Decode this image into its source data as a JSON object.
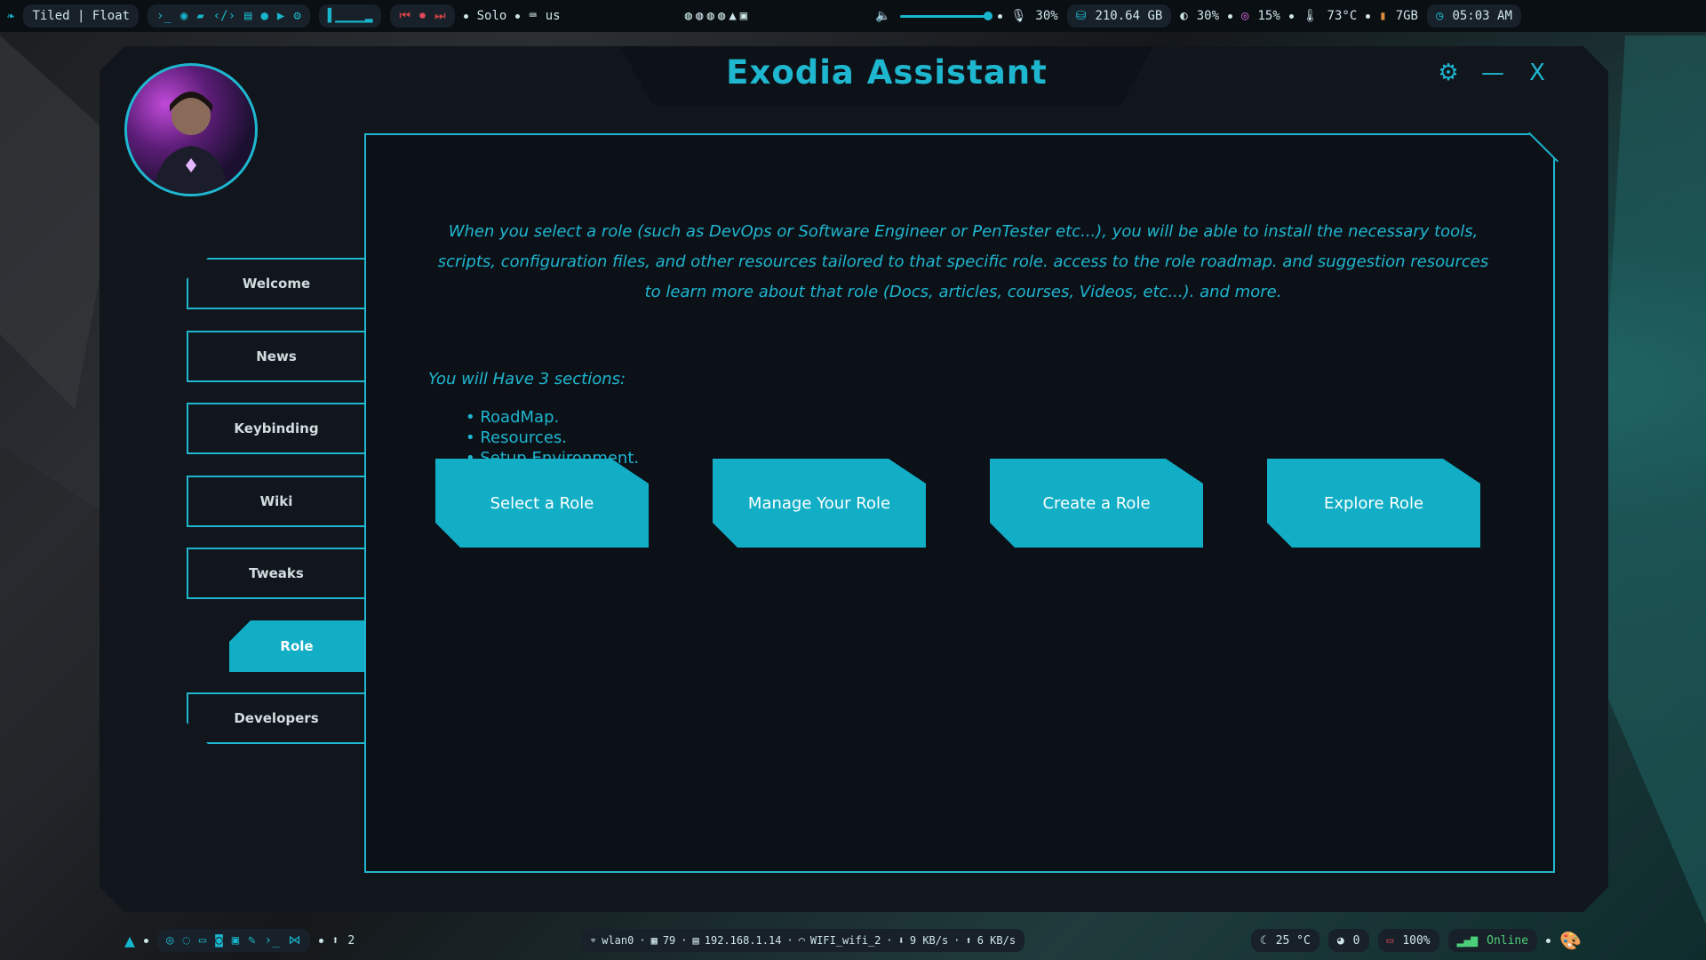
{
  "topbar": {
    "layout_label": "Tiled | Float",
    "mode": "Solo",
    "keyboard": "us",
    "volume": "30%",
    "disk": "210.64 GB",
    "brightness": "30%",
    "cpu": "15%",
    "temp": "73°C",
    "ram": "7GB",
    "clock": "05:03 AM",
    "volume_level": 0.95,
    "accent_color": "#18b6cc"
  },
  "window": {
    "title": "Exodia Assistant",
    "settings_icon": "gear-icon",
    "minimize_icon": "minimize-icon",
    "close_icon": "close-icon",
    "minimize_label": "—",
    "close_label": "X",
    "settings_label": "⚙"
  },
  "nav": {
    "items": [
      {
        "label": "Welcome"
      },
      {
        "label": "News"
      },
      {
        "label": "Keybinding"
      },
      {
        "label": "Wiki"
      },
      {
        "label": "Tweaks"
      },
      {
        "label": "Role",
        "active": true
      },
      {
        "label": "Developers"
      }
    ]
  },
  "content": {
    "intro": "When you select a role (such as DevOps or Software Engineer or PenTester etc...), you will be able to install the necessary tools, scripts, configuration files, and other resources tailored to that specific role. access to the role roadmap. and suggestion resources to learn more about that role (Docs, articles, courses, Videos, etc...). and more.",
    "sections_label": "You will Have 3 sections:",
    "sections": [
      "RoadMap.",
      "Resources.",
      "Setup Environment."
    ],
    "buttons": [
      "Select a Role",
      "Manage Your Role",
      "Create a Role",
      "Explore Role"
    ]
  },
  "bottombar": {
    "workspace_count": "2",
    "wifi_iface": "wlan0",
    "signal": "79",
    "ip": "192.168.1.14",
    "ssid": "WIFI_wifi_2",
    "down": "9 KB/s",
    "up": "6 KB/s",
    "weather": "25 °C",
    "github": "0",
    "battery": "100%",
    "status": "Online"
  }
}
